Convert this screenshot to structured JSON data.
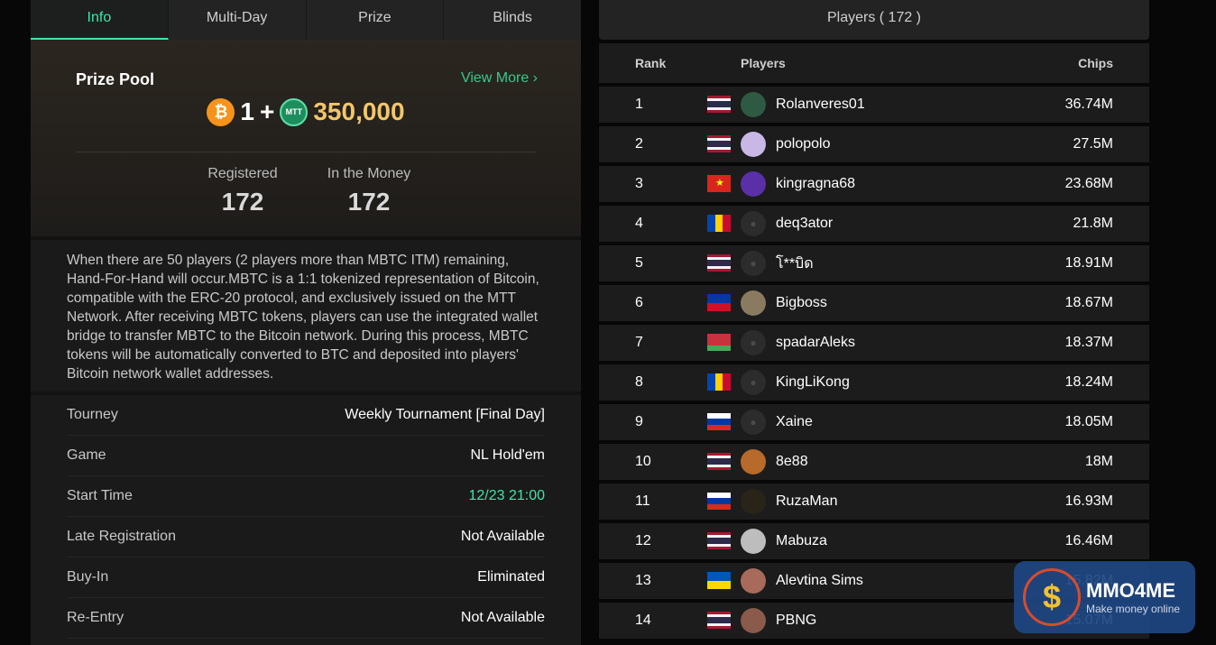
{
  "tabs": [
    {
      "label": "Info",
      "active": true
    },
    {
      "label": "Multi-Day",
      "active": false
    },
    {
      "label": "Prize",
      "active": false
    },
    {
      "label": "Blinds",
      "active": false
    }
  ],
  "prize": {
    "title": "Prize Pool",
    "view_more": "View More ›",
    "btc_amount": "1",
    "plus": "+",
    "mtt_amount": "350,000",
    "mtt_coin_label": "MTT",
    "btc_coin_symbol": "₿",
    "registered_label": "Registered",
    "registered_value": "172",
    "itm_label": "In the Money",
    "itm_value": "172"
  },
  "description": "When there are 50 players (2 players more than MBTC ITM) remaining, Hand-For-Hand will occur.MBTC is a 1:1 tokenized representation of Bitcoin, compatible with the ERC-20 protocol, and exclusively issued on the MTT Network. After receiving MBTC tokens, players can use the integrated wallet bridge to transfer MBTC to the Bitcoin network. During this process, MBTC tokens will be automatically converted to BTC and deposited into players' Bitcoin network wallet addresses.",
  "details": [
    {
      "label": "Tourney",
      "value": "Weekly Tournament [Final Day]",
      "green": false
    },
    {
      "label": "Game",
      "value": "NL Hold'em",
      "green": false
    },
    {
      "label": "Start Time",
      "value": "12/23 21:00",
      "green": true
    },
    {
      "label": "Late Registration",
      "value": "Not Available",
      "green": false
    },
    {
      "label": "Buy-In",
      "value": "Eliminated",
      "green": false
    },
    {
      "label": "Re-Entry",
      "value": "Not Available",
      "green": false
    }
  ],
  "players_panel": {
    "header": "Players ( 172 )",
    "col_rank": "Rank",
    "col_players": "Players",
    "col_chips": "Chips"
  },
  "players": [
    {
      "rank": "1",
      "name": "Rolanveres01",
      "chips": "36.74M",
      "flag": "thailand",
      "avatar": "#2e5a44"
    },
    {
      "rank": "2",
      "name": "polopolo",
      "chips": "27.5M",
      "flag": "thailand",
      "avatar": "#c9b8e6"
    },
    {
      "rank": "3",
      "name": "kingragna68",
      "chips": "23.68M",
      "flag": "vietnam",
      "avatar": "#5b2fa8"
    },
    {
      "rank": "4",
      "name": "deq3ator",
      "chips": "21.8M",
      "flag": "moldova",
      "avatar": "#2c2c2c"
    },
    {
      "rank": "5",
      "name": "โ**บิด",
      "chips": "18.91M",
      "flag": "thailand",
      "avatar": "#2c2c2c"
    },
    {
      "rank": "6",
      "name": "Bigboss",
      "chips": "18.67M",
      "flag": "philippines",
      "avatar": "#8a7a60"
    },
    {
      "rank": "7",
      "name": "spadarAleks",
      "chips": "18.37M",
      "flag": "belarus",
      "avatar": "#2c2c2c"
    },
    {
      "rank": "8",
      "name": "KingLiKong",
      "chips": "18.24M",
      "flag": "moldova",
      "avatar": "#2c2c2c"
    },
    {
      "rank": "9",
      "name": "Xaine",
      "chips": "18.05M",
      "flag": "russia",
      "avatar": "#2c2c2c"
    },
    {
      "rank": "10",
      "name": "8e88",
      "chips": "18M",
      "flag": "thailand",
      "avatar": "#b86a2a"
    },
    {
      "rank": "11",
      "name": "RuzaMan",
      "chips": "16.93M",
      "flag": "russia",
      "avatar": "#2a2418"
    },
    {
      "rank": "12",
      "name": "Mabuza",
      "chips": "16.46M",
      "flag": "thailand",
      "avatar": "#bdbdbd"
    },
    {
      "rank": "13",
      "name": "Alevtina Sims",
      "chips": "15.82M",
      "flag": "ukraine",
      "avatar": "#a86a5a"
    },
    {
      "rank": "14",
      "name": "PBNG",
      "chips": "15.07M",
      "flag": "thailand",
      "avatar": "#8a5a4a"
    }
  ],
  "watermark": {
    "title": "MMO4ME",
    "subtitle": "Make money online",
    "icon_symbol": "$"
  },
  "colors": {
    "accent_green": "#3ee6a8",
    "gold": "#f2c66a",
    "btc_orange": "#f7931a"
  }
}
